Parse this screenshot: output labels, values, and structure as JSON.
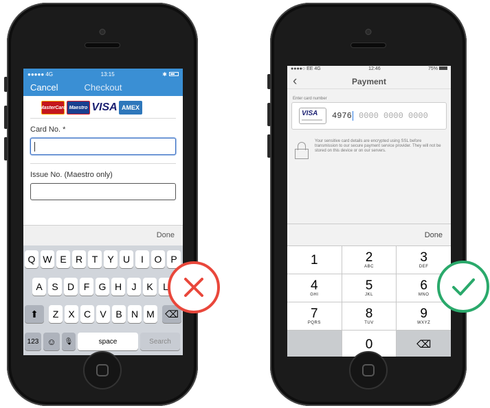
{
  "left_phone": {
    "status": {
      "carrier": "●●●●● 4G",
      "time": "13:15",
      "bluetooth": "✱"
    },
    "nav": {
      "cancel": "Cancel",
      "title": "Checkout"
    },
    "card_logos": [
      "MasterCard",
      "Maestro",
      "VISA",
      "AMEX"
    ],
    "fields": [
      {
        "label": "Card No. *",
        "value": ""
      },
      {
        "label": "Issue No. (Maestro only)",
        "value": ""
      }
    ],
    "done": "Done",
    "keyboard": {
      "row1": [
        "Q",
        "W",
        "E",
        "R",
        "T",
        "Y",
        "U",
        "I",
        "O",
        "P"
      ],
      "row2": [
        "A",
        "S",
        "D",
        "F",
        "G",
        "H",
        "J",
        "K",
        "L"
      ],
      "row3": [
        "Z",
        "X",
        "C",
        "V",
        "B",
        "N",
        "M"
      ],
      "shift": "⬆",
      "backspace": "⌫",
      "mode": "123",
      "emoji": "☺",
      "mic": "🎙",
      "space": "space",
      "search": "Search"
    },
    "badge": {
      "icon": "cross-icon",
      "color": "#e9473b"
    }
  },
  "right_phone": {
    "status": {
      "carrier": "●●●●○ EE  4G",
      "time": "12:46",
      "battery": "75%"
    },
    "nav": {
      "back": "‹",
      "title": "Payment"
    },
    "card_field": {
      "label": "Enter card number",
      "brand": "VISA",
      "typed": "4976",
      "placeholder_rest": "0000 0000 0000"
    },
    "security_note": "Your sensitive card details are encrypted using SSL before transmission to our secure payment service provider. They will not be stored on this device or on our servers.",
    "done": "Done",
    "keypad": [
      [
        {
          "d": "1",
          "s": ""
        },
        {
          "d": "2",
          "s": "ABC"
        },
        {
          "d": "3",
          "s": "DEF"
        }
      ],
      [
        {
          "d": "4",
          "s": "GHI"
        },
        {
          "d": "5",
          "s": "JKL"
        },
        {
          "d": "6",
          "s": "MNO"
        }
      ],
      [
        {
          "d": "7",
          "s": "PQRS"
        },
        {
          "d": "8",
          "s": "TUV"
        },
        {
          "d": "9",
          "s": "WXYZ"
        }
      ]
    ],
    "zero": "0",
    "delete_icon": "⌫",
    "badge": {
      "icon": "checkmark-icon",
      "color": "#2aa96b"
    }
  }
}
